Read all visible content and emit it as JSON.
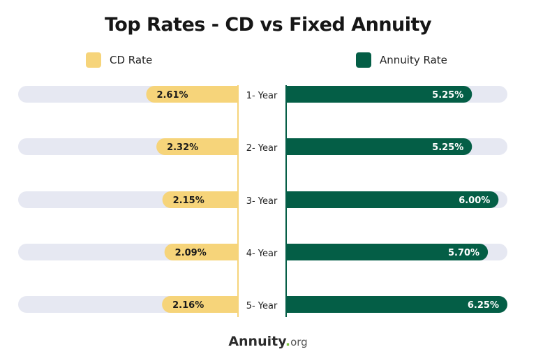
{
  "chart_data": {
    "type": "bar",
    "layout": "diverging-horizontal",
    "title": "Top Rates - CD vs Fixed Annuity",
    "categories": [
      "1- Year",
      "2- Year",
      "3- Year",
      "4- Year",
      "5- Year"
    ],
    "series": [
      {
        "name": "CD Rate",
        "color": "#f6d47a",
        "direction": "left",
        "values": [
          2.61,
          2.32,
          2.15,
          2.09,
          2.16
        ],
        "labels": [
          "2.61%",
          "2.32%",
          "2.15%",
          "2.09%",
          "2.16%"
        ]
      },
      {
        "name": "Annuity Rate",
        "color": "#045e46",
        "direction": "right",
        "values": [
          5.25,
          5.25,
          6.0,
          5.7,
          6.25
        ],
        "labels": [
          "5.25%",
          "5.25%",
          "6.00%",
          "5.70%",
          "6.25%"
        ]
      }
    ],
    "xlim": [
      0,
      6.25
    ],
    "track_color": "#e6e8f2",
    "legend_position": "top",
    "grid": false,
    "xlabel": "",
    "ylabel": ""
  },
  "brand": {
    "name": "Annuity",
    "dot": ".",
    "suffix": "org",
    "dot_color": "#7cc242"
  }
}
